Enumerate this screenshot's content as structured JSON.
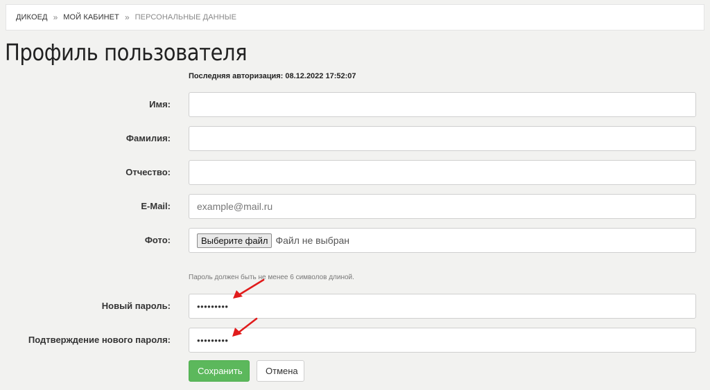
{
  "breadcrumb": {
    "items": [
      {
        "label": "Дикоед"
      },
      {
        "label": "Мой кабинет"
      },
      {
        "label": "Персональные данные"
      }
    ],
    "separator": "»"
  },
  "page": {
    "title": "Профиль пользователя",
    "last_auth": "Последняя авторизация: 08.12.2022 17:52:07"
  },
  "form": {
    "first_name": {
      "label": "Имя:",
      "value": ""
    },
    "last_name": {
      "label": "Фамилия:",
      "value": ""
    },
    "middle_name": {
      "label": "Отчество:",
      "value": ""
    },
    "email": {
      "label": "E-Mail:",
      "value": "",
      "placeholder": "example@mail.ru"
    },
    "photo": {
      "label": "Фото:",
      "button_label": "Выберите файл",
      "status": "Файл не выбран"
    },
    "password_hint": "Пароль должен быть не менее 6 символов длиной.",
    "new_password": {
      "label": "Новый пароль:",
      "value": "•••••••••"
    },
    "confirm_password": {
      "label": "Подтверждение нового пароля:",
      "value": "•••••••••"
    }
  },
  "actions": {
    "save_label": "Сохранить",
    "cancel_label": "Отмена"
  },
  "colors": {
    "accent_green": "#5cb85c",
    "annotation_arrow": "#e11b1b"
  },
  "icons": {
    "annotation": "red-arrow-icon"
  }
}
